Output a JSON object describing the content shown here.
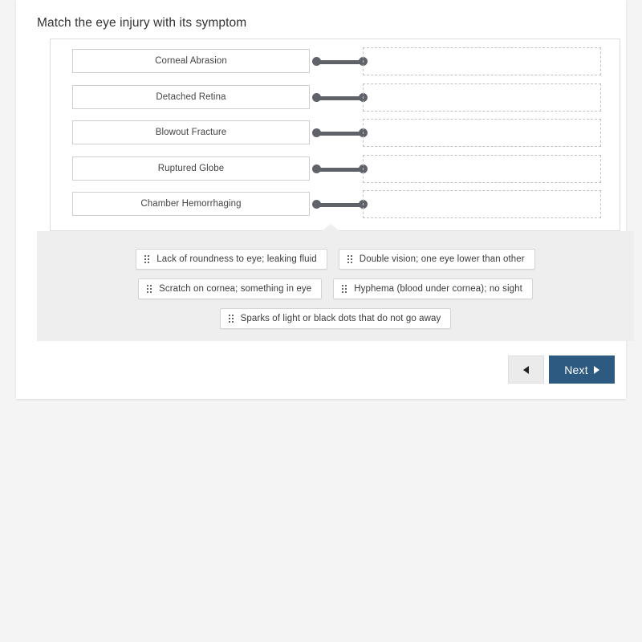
{
  "question": {
    "prompt": "Match the eye injury with its symptom"
  },
  "match_panel": {
    "rows": [
      {
        "term": "Corneal Abrasion",
        "connector_icon": "link-connector-icon",
        "drop_zone_content": ""
      },
      {
        "term": "Detached Retina",
        "connector_icon": "link-connector-icon",
        "drop_zone_content": ""
      },
      {
        "term": "Blowout Fracture",
        "connector_icon": "link-connector-icon",
        "drop_zone_content": ""
      },
      {
        "term": "Ruptured Globe",
        "connector_icon": "link-connector-icon",
        "drop_zone_content": ""
      },
      {
        "term": "Chamber Hemorrhaging",
        "connector_icon": "link-connector-icon",
        "drop_zone_content": ""
      }
    ]
  },
  "answer_tray": {
    "handle_icon": "drag-handle-icon",
    "rows": [
      [
        {
          "text": "Lack of roundness to eye; leaking fluid"
        },
        {
          "text": "Double vision; one eye lower than other"
        }
      ],
      [
        {
          "text": "Scratch on cornea; something in eye"
        },
        {
          "text": "Hyphema (blood under cornea); no sight"
        }
      ],
      [
        {
          "text": "Sparks of light or black dots that do not go away"
        }
      ]
    ]
  },
  "navigation": {
    "prev_label": "",
    "prev_icon": "triangle-left-icon",
    "next_label": "Next",
    "next_icon": "triangle-right-icon"
  },
  "colors": {
    "page_background": "#f4f4f4",
    "card_background": "#ffffff",
    "tray_background": "#eeeeee",
    "connector": "#5f6369",
    "next_button": "#2d5a80",
    "prev_button": "#ebebeb",
    "panel_border": "#dddddd",
    "dropzone_border": "#c3c3c3",
    "text": "#333333"
  }
}
